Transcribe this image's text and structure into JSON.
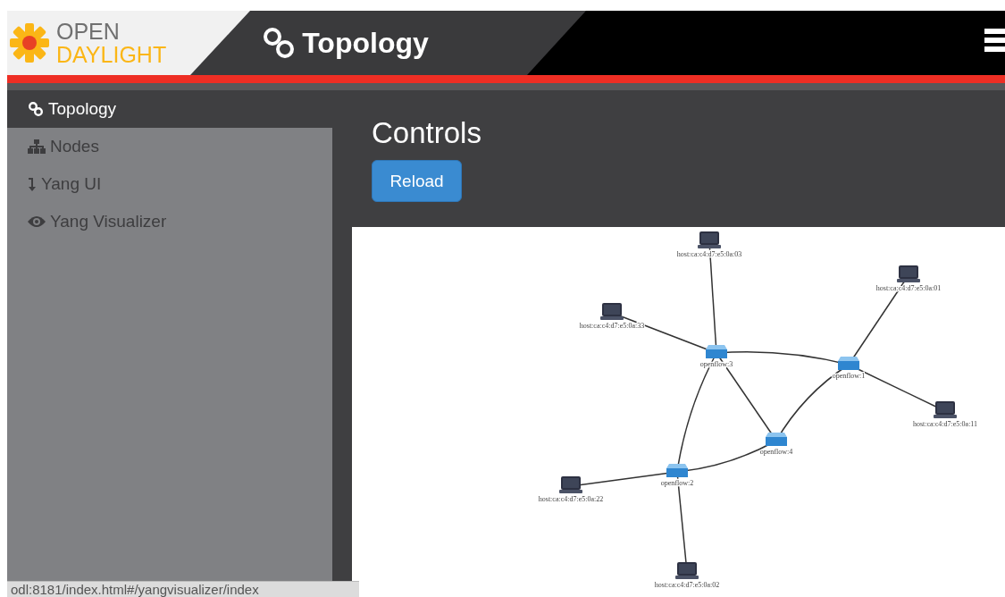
{
  "header": {
    "logo": {
      "top": "OPEN",
      "bottom": "DAYLIGHT"
    },
    "title": "Topology"
  },
  "sidebar": {
    "items": [
      {
        "label": "Topology",
        "selected": true
      },
      {
        "label": "Nodes",
        "selected": false
      },
      {
        "label": "Yang UI",
        "selected": false
      },
      {
        "label": "Yang Visualizer",
        "selected": false
      }
    ]
  },
  "main": {
    "heading": "Controls",
    "buttons": [
      "Reload"
    ]
  },
  "topology": {
    "nodes": [
      {
        "kind": "host",
        "label": "host:ca:c4:d7:e5:0a:03"
      },
      {
        "kind": "host",
        "label": "host:ca:c4:d7:e5:0a:01"
      },
      {
        "kind": "host",
        "label": "host:ca:c4:d7:e5:0a:33"
      },
      {
        "kind": "switch",
        "label": "openflow:3"
      },
      {
        "kind": "switch",
        "label": "openflow:1"
      },
      {
        "kind": "host",
        "label": "host:ca:c4:d7:e5:0a:11"
      },
      {
        "kind": "switch",
        "label": "openflow:4"
      },
      {
        "kind": "switch",
        "label": "openflow:2"
      },
      {
        "kind": "host",
        "label": "host:ca:c4:d7:e5:0a:22"
      },
      {
        "kind": "host",
        "label": "host:ca:c4:d7:e5:0a:02"
      }
    ]
  },
  "status_bar": "odl:8181/index.html#/yangvisualizer/index"
}
